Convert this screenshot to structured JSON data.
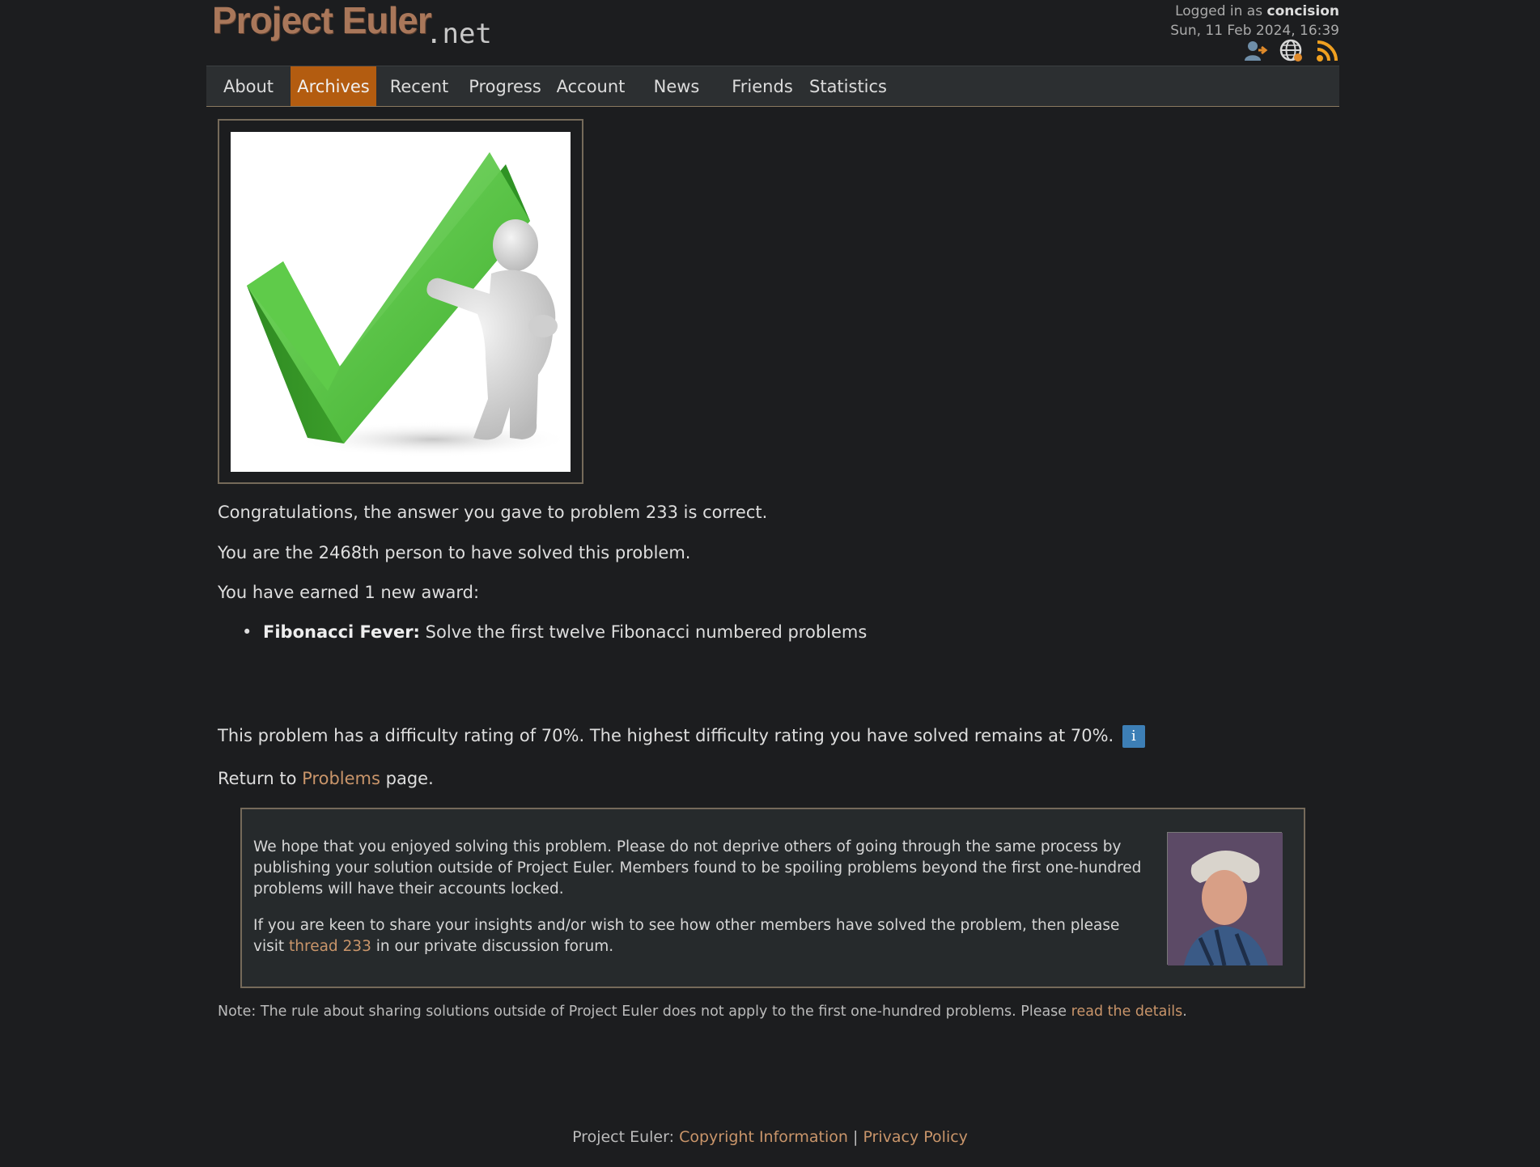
{
  "header": {
    "logo_main": "Project Euler",
    "logo_suffix": ".net",
    "logged_in_prefix": "Logged in as",
    "username": "concision",
    "datetime": "Sun, 11 Feb 2024, 16:39"
  },
  "nav": {
    "items": [
      "About",
      "Archives",
      "Recent",
      "Progress",
      "Account",
      "News",
      "Friends",
      "Statistics"
    ],
    "active": "Archives"
  },
  "result": {
    "congrats": "Congratulations, the answer you gave to problem 233 is correct.",
    "rank": "You are the 2468th person to have solved this problem.",
    "award_intro": "You have earned 1 new award:",
    "award_name": "Fibonacci Fever:",
    "award_desc": "Solve the first twelve Fibonacci numbered problems",
    "difficulty": "This problem has a difficulty rating of 70%. The highest difficulty rating you have solved remains at 70%.",
    "info_glyph": "i",
    "return_prefix": "Return to",
    "return_link": "Problems",
    "return_suffix": "page."
  },
  "notice": {
    "para1": "We hope that you enjoyed solving this problem. Please do not deprive others of going through the same process by publishing your solution outside of Project Euler. Members found to be spoiling problems beyond the first one-hundred problems will have their accounts locked.",
    "para2_prefix": "If you are keen to share your insights and/or wish to see how other members have solved the problem, then please visit",
    "para2_link": "thread 233",
    "para2_suffix": "in our private discussion forum."
  },
  "note": {
    "text": "Note: The rule about sharing solutions outside of Project Euler does not apply to the first one-hundred problems. Please",
    "link": "read the details",
    "suffix": "."
  },
  "footer": {
    "prefix": "Project Euler:",
    "copyright": "Copyright Information",
    "separator": "|",
    "privacy": "Privacy Policy"
  },
  "icons": {
    "logout": "logout-icon",
    "globe": "globe-icon",
    "rss": "rss-icon",
    "accent": "#b35c10",
    "link": "#c9956a"
  }
}
